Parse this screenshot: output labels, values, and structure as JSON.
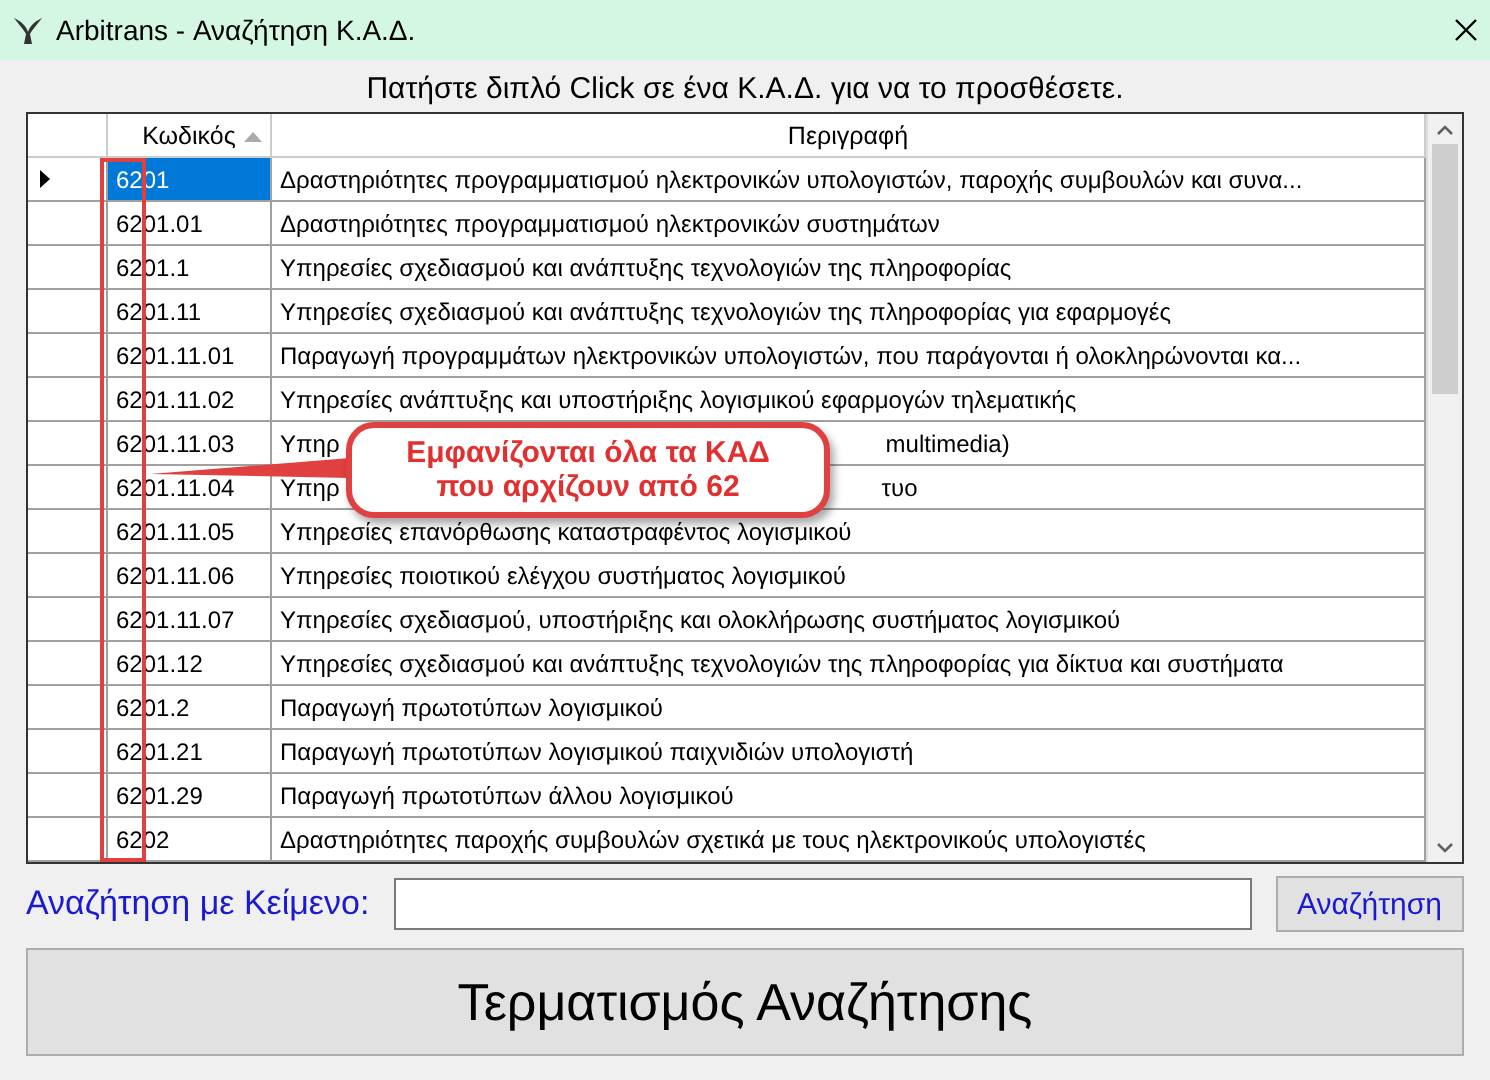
{
  "window": {
    "title": "Arbitrans - Αναζήτηση Κ.Α.Δ."
  },
  "instruction": "Πατήστε διπλό Click σε ένα Κ.Α.Δ. για να το προσθέσετε.",
  "table": {
    "columns": [
      {
        "label": "Κωδικός",
        "sorted": true
      },
      {
        "label": "Περιγραφή",
        "sorted": false
      }
    ],
    "rows": [
      {
        "code": "6201",
        "selected": true,
        "description": [
          "Δραστηριότητες προγραμματισμού ηλεκτρονικών υπολογιστών, παροχής συμβουλών και συνα..."
        ]
      },
      {
        "code": "6201.01",
        "selected": false,
        "description": [
          "Δραστηριότητες προγραμματισμού ηλεκτρονικών συστημάτων"
        ]
      },
      {
        "code": "6201.1",
        "selected": false,
        "description": [
          "Υπηρεσίες σχεδιασμού και ανάπτυξης τεχνολογιών της πληροφορίας"
        ]
      },
      {
        "code": "6201.11",
        "selected": false,
        "description": [
          "Υπηρεσίες σχεδιασμού και ανάπτυξης τεχνολογιών της πληροφορίας για εφαρμογές"
        ]
      },
      {
        "code": "6201.11.01",
        "selected": false,
        "description": [
          "Παραγωγή προγραμμάτων ηλεκτρονικών υπολογιστών, που παράγονται ή ολοκληρώνονται κα..."
        ]
      },
      {
        "code": "6201.11.02",
        "selected": false,
        "description": [
          "Υπηρεσίες ανάπτυξης και υποστήριξης λογισμικού εφαρμογών τηλεματικής"
        ]
      },
      {
        "code": "6201.11.03",
        "selected": false,
        "description": [
          "Υπηρ",
          "multimedia)"
        ]
      },
      {
        "code": "6201.11.04",
        "selected": false,
        "description": [
          "Υπηρ",
          "τυο"
        ]
      },
      {
        "code": "6201.11.05",
        "selected": false,
        "description": [
          "Υπηρεσίες επανόρθωσης καταστραφέντος λογισμικού"
        ]
      },
      {
        "code": "6201.11.06",
        "selected": false,
        "description": [
          "Υπηρεσίες ποιοτικού ελέγχου συστήματος λογισμικού"
        ]
      },
      {
        "code": "6201.11.07",
        "selected": false,
        "description": [
          "Υπηρεσίες σχεδιασμού, υποστήριξης και ολοκλήρωσης συστήματος λογισμικού"
        ]
      },
      {
        "code": "6201.12",
        "selected": false,
        "description": [
          "Υπηρεσίες σχεδιασμού και ανάπτυξης τεχνολογιών της πληροφορίας για δίκτυα και συστήματα"
        ]
      },
      {
        "code": "6201.2",
        "selected": false,
        "description": [
          "Παραγωγή πρωτοτύπων λογισμικού"
        ]
      },
      {
        "code": "6201.21",
        "selected": false,
        "description": [
          "Παραγωγή πρωτοτύπων λογισμικού παιχνιδιών υπολογιστή"
        ]
      },
      {
        "code": "6201.29",
        "selected": false,
        "description": [
          "Παραγωγή πρωτοτύπων άλλου λογισμικού"
        ]
      },
      {
        "code": "6202",
        "selected": false,
        "description": [
          "Δραστηριότητες παροχής συμβουλών σχετικά με τους ηλεκτρονικούς υπολογιστές"
        ]
      }
    ]
  },
  "annotation": {
    "lines": [
      "Εμφανίζονται όλα τα ΚΑΔ",
      "που αρχίζουν από 62"
    ]
  },
  "search": {
    "label": "Αναζήτηση με Κείμενο:",
    "button": "Αναζήτηση"
  },
  "end_button": "Τερματισμός Αναζήτησης"
}
